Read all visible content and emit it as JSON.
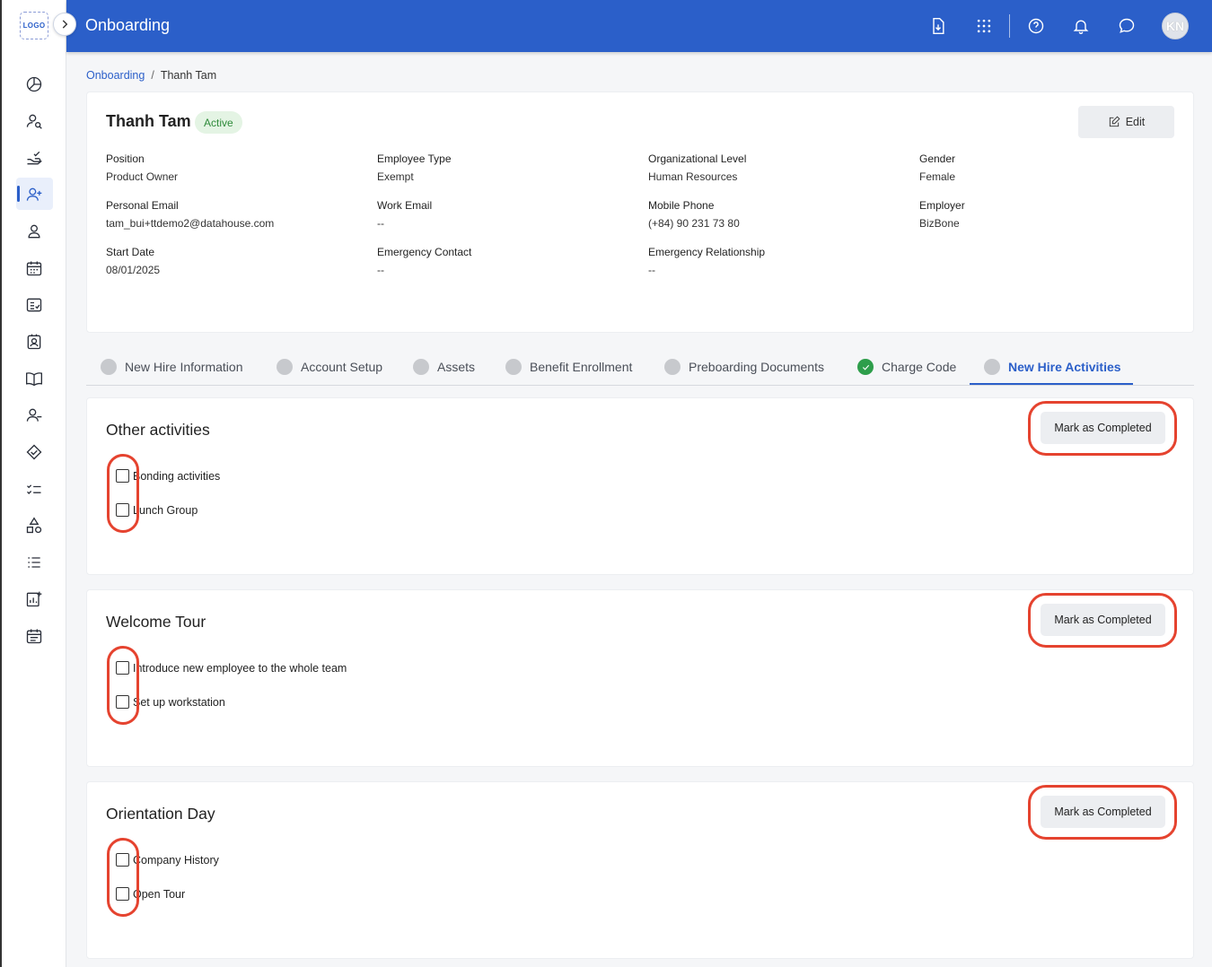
{
  "app": {
    "title": "Onboarding",
    "logo_text": "LOGO"
  },
  "header": {
    "icons": [
      "download-icon",
      "apps-grid-icon",
      "help-icon",
      "bell-icon",
      "chat-icon"
    ],
    "avatar_initials": "KN"
  },
  "breadcrumb": {
    "parent": "Onboarding",
    "separator": "/",
    "current": "Thanh Tam"
  },
  "profile": {
    "name": "Thanh Tam",
    "status": "Active",
    "edit_label": "Edit",
    "fields": {
      "position": {
        "label": "Position",
        "value": "Product Owner"
      },
      "employee_type": {
        "label": "Employee Type",
        "value": "Exempt"
      },
      "org_level": {
        "label": "Organizational Level",
        "value": "Human Resources"
      },
      "gender": {
        "label": "Gender",
        "value": "Female"
      },
      "personal_email": {
        "label": "Personal Email",
        "value": "tam_bui+ttdemo2@datahouse.com"
      },
      "work_email": {
        "label": "Work Email",
        "value": "--"
      },
      "mobile_phone": {
        "label": "Mobile Phone",
        "value": "(+84) 90 231 73 80"
      },
      "employer": {
        "label": "Employer",
        "value": "BizBone"
      },
      "start_date": {
        "label": "Start Date",
        "value": "08/01/2025"
      },
      "emergency_contact": {
        "label": "Emergency Contact",
        "value": "--"
      },
      "emergency_relationship": {
        "label": "Emergency Relationship",
        "value": "--"
      }
    }
  },
  "tabs": [
    {
      "label": "New Hire Information",
      "status": "pending"
    },
    {
      "label": "Account Setup",
      "status": "pending"
    },
    {
      "label": "Assets",
      "status": "pending"
    },
    {
      "label": "Benefit Enrollment",
      "status": "pending"
    },
    {
      "label": "Preboarding Documents",
      "status": "pending"
    },
    {
      "label": "Charge Code",
      "status": "complete"
    },
    {
      "label": "New Hire Activities",
      "status": "pending",
      "active": true
    }
  ],
  "sections": [
    {
      "title": "Other activities",
      "button": "Mark as Completed",
      "tasks": [
        {
          "label": "Bonding activities",
          "checked": false
        },
        {
          "label": "Lunch Group",
          "checked": false
        }
      ]
    },
    {
      "title": "Welcome Tour",
      "button": "Mark as Completed",
      "tasks": [
        {
          "label": "Introduce new employee to the whole team",
          "checked": false
        },
        {
          "label": "Set up workstation",
          "checked": false
        }
      ]
    },
    {
      "title": "Orientation Day",
      "button": "Mark as Completed",
      "tasks": [
        {
          "label": "Company History",
          "checked": false
        },
        {
          "label": "Open Tour",
          "checked": false
        }
      ]
    }
  ],
  "colors": {
    "primary": "#2b5fc9",
    "highlight_ring": "#e5432f",
    "complete": "#2e9e4b",
    "active_badge_bg": "#e4f4e4"
  }
}
